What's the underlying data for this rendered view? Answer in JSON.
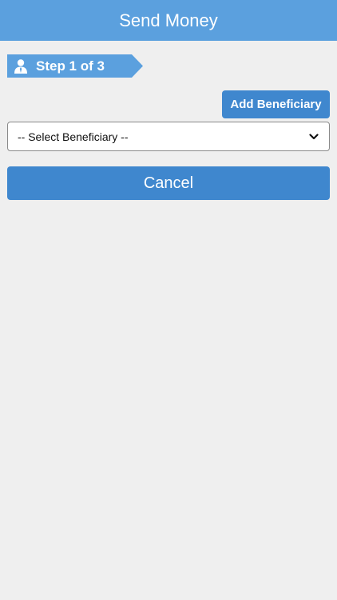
{
  "header": {
    "title": "Send Money"
  },
  "step": {
    "label": "Step 1 of 3",
    "icon": "user-icon"
  },
  "beneficiary": {
    "add_label": "Add Beneficiary",
    "select_value": "-- Select Beneficiary --",
    "select_icon": "chevron-down-icon"
  },
  "actions": {
    "cancel_label": "Cancel"
  },
  "colors": {
    "header_bg": "#5ba0de",
    "button_bg": "#3f87ce",
    "page_bg": "#efefef"
  }
}
